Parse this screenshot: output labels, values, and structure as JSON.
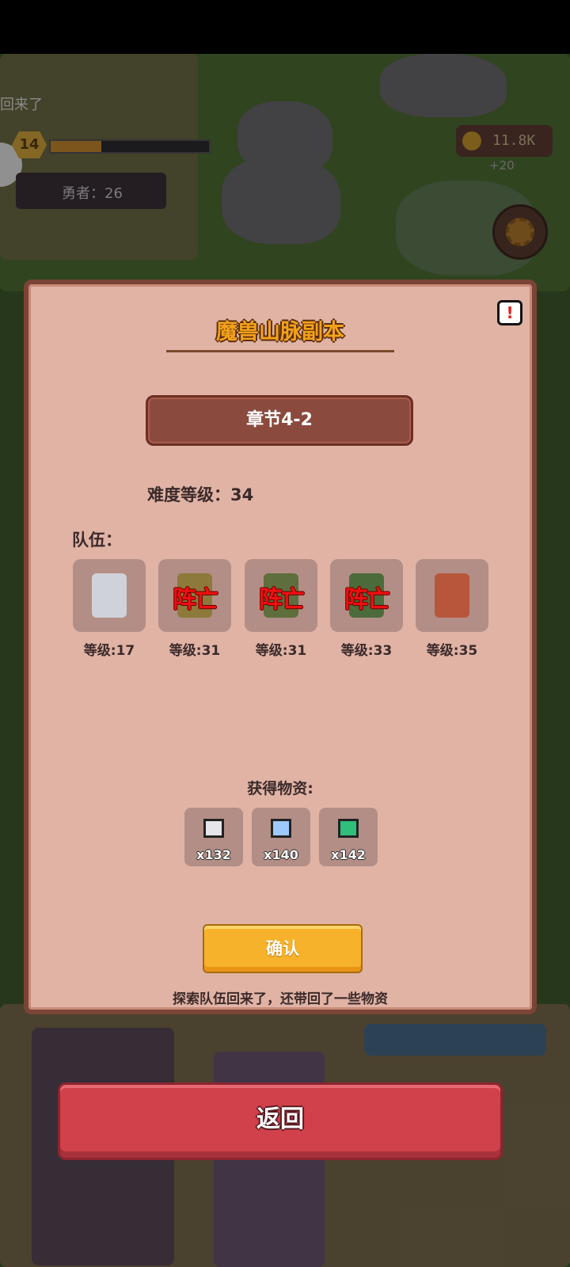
{
  "topbar": {
    "message_fragment": "回来了"
  },
  "player": {
    "level": "14",
    "xp_progress": 0.32,
    "heroes_label": "勇者：26"
  },
  "currency": {
    "gold": "11.8K",
    "gold_rate": "+20"
  },
  "dialog": {
    "title": "魔兽山脉副本",
    "chapter": "章节4-2",
    "difficulty": "难度等级：34",
    "team_label": "队伍：",
    "heroes": [
      {
        "level": "等级:17",
        "dead": "",
        "color": "#cfd2d8"
      },
      {
        "level": "等级:31",
        "dead": "阵亡",
        "color": "#8d7a3a"
      },
      {
        "level": "等级:31",
        "dead": "阵亡",
        "color": "#5e6e3c"
      },
      {
        "level": "等级:33",
        "dead": "阵亡",
        "color": "#4c6b3a"
      },
      {
        "level": "等级:35",
        "dead": "",
        "color": "#b8563c"
      }
    ],
    "loot_title": "获得物资:",
    "loot": [
      {
        "qty": "x132",
        "icon": "silver-ore-icon",
        "color": "#e6e6ea"
      },
      {
        "qty": "x140",
        "icon": "crystal-icon",
        "color": "#9ec9ff"
      },
      {
        "qty": "x142",
        "icon": "emerald-icon",
        "color": "#2fbf7a"
      }
    ],
    "confirm_label": "确认",
    "footer_message": "探索队伍回来了，还带回了一些物资"
  },
  "back_label": "返回"
}
